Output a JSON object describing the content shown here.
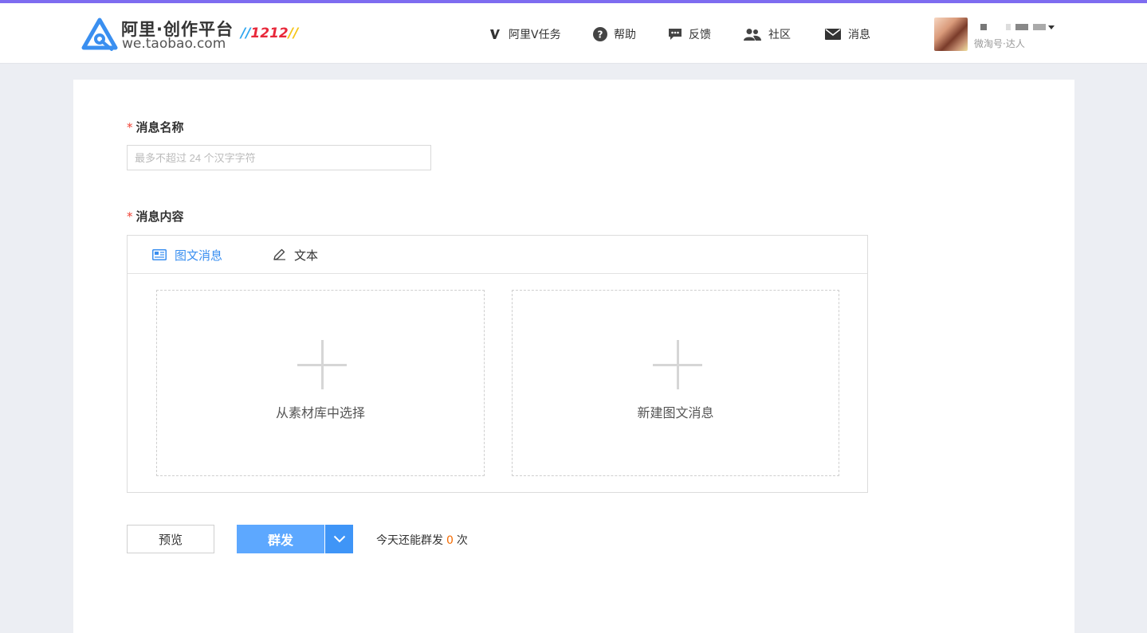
{
  "brand": {
    "title": "阿里·创作平台",
    "url": "we.taobao.com",
    "badge": "1212",
    "accent_color": "#7e6cf0",
    "logo_color": "#3a8ff0"
  },
  "nav": {
    "items": [
      {
        "label": "阿里V任务",
        "icon": "v-task-icon"
      },
      {
        "label": "帮助",
        "icon": "help-icon"
      },
      {
        "label": "反馈",
        "icon": "feedback-icon"
      },
      {
        "label": "社区",
        "icon": "community-icon"
      },
      {
        "label": "消息",
        "icon": "mail-icon"
      }
    ]
  },
  "user": {
    "role": "微淘号·达人"
  },
  "form": {
    "name": {
      "required_mark": "*",
      "label": "消息名称",
      "placeholder": "最多不超过 24 个汉字字符",
      "value": ""
    },
    "content": {
      "required_mark": "*",
      "label": "消息内容",
      "tabs": [
        {
          "label": "图文消息",
          "active": true,
          "icon": "image-text-icon"
        },
        {
          "label": "文本",
          "active": false,
          "icon": "pencil-icon"
        }
      ],
      "slots": [
        {
          "label": "从素材库中选择",
          "icon": "plus-icon"
        },
        {
          "label": "新建图文消息",
          "icon": "plus-icon"
        }
      ]
    }
  },
  "actions": {
    "preview_label": "预览",
    "send_label": "群发",
    "quota_prefix": "今天还能群发",
    "quota_count": "0",
    "quota_suffix": "次",
    "primary_color": "#5da8ff",
    "quota_color": "#f56a00"
  }
}
